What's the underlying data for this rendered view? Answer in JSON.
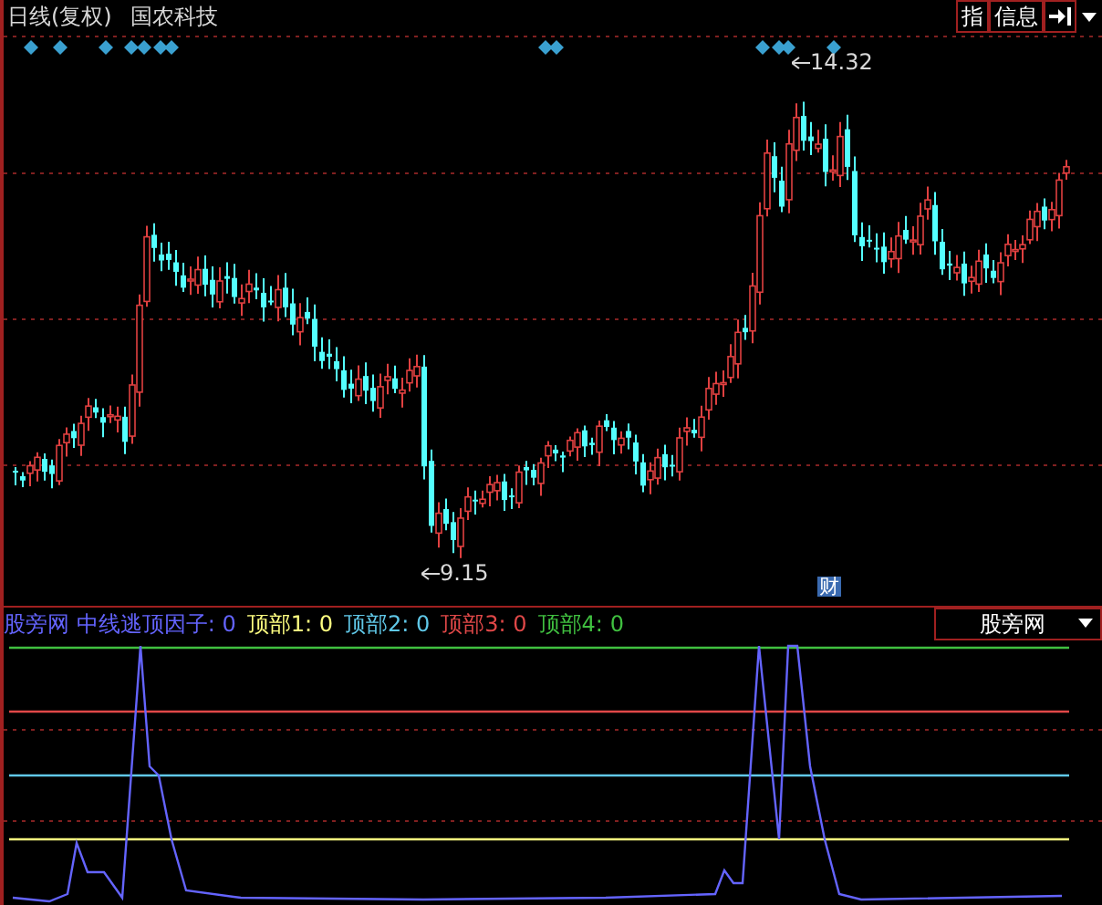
{
  "header": {
    "period": "日线(复权)",
    "stock": "国农科技",
    "buttons": [
      {
        "label": "指"
      },
      {
        "label": "信息"
      }
    ]
  },
  "main_chart": {
    "annotations": [
      {
        "kind": "high",
        "label": "14.32"
      },
      {
        "kind": "low",
        "label": "9.15"
      }
    ],
    "event_badge": "财"
  },
  "indicator": {
    "items": [
      {
        "label": "股旁网 中线逃顶因子:",
        "value": "0",
        "color": "#6464ff"
      },
      {
        "label": "顶部1:",
        "value": "0",
        "color": "#ffff80"
      },
      {
        "label": "顶部2:",
        "value": "0",
        "color": "#60c8e8"
      },
      {
        "label": "顶部3:",
        "value": "0",
        "color": "#e04848"
      },
      {
        "label": "顶部4:",
        "value": "0",
        "color": "#40c040"
      }
    ],
    "selector": "股旁网"
  }
}
